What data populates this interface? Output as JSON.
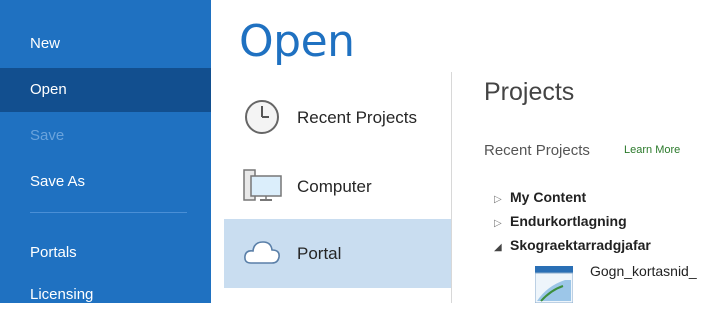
{
  "nav": {
    "items": [
      {
        "label": "New",
        "state": "normal"
      },
      {
        "label": "Open",
        "state": "active"
      },
      {
        "label": "Save",
        "state": "disabled"
      },
      {
        "label": "Save As",
        "state": "normal"
      },
      {
        "label": "Portals",
        "state": "normal"
      },
      {
        "label": "Licensing",
        "state": "normal"
      }
    ]
  },
  "page_title": "Open",
  "locations": [
    {
      "label": "Recent Projects",
      "icon": "clock-icon"
    },
    {
      "label": "Computer",
      "icon": "computer-icon"
    },
    {
      "label": "Portal",
      "icon": "cloud-icon",
      "selected": true
    }
  ],
  "projects_panel": {
    "title": "Projects",
    "recent_label": "Recent Projects",
    "learn_more": "Learn More",
    "tree": [
      {
        "label": "My Content",
        "expanded": false
      },
      {
        "label": "Endurkortlagning",
        "expanded": false
      },
      {
        "label": "Skograektarradgjafar",
        "expanded": true
      }
    ],
    "project_item": {
      "name": "Gogn_kortasnid_",
      "icon": "project-thumbnail-icon"
    }
  },
  "colors": {
    "nav_bg": "#1f71c1",
    "nav_active": "#124f8f",
    "accent": "#1f71c1",
    "selected_bg": "#c9ddf0"
  }
}
